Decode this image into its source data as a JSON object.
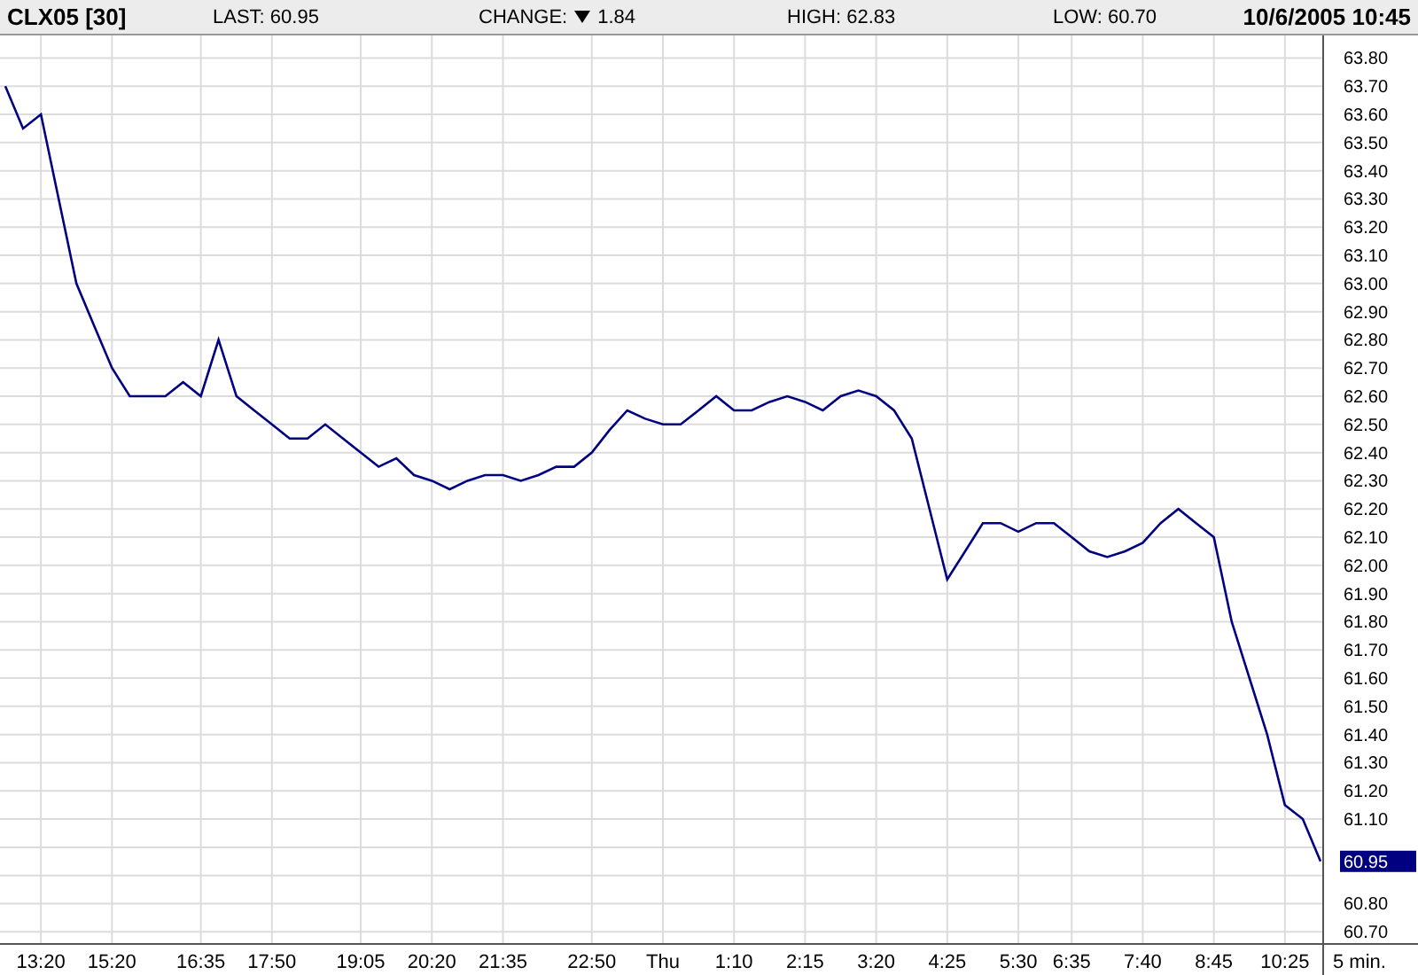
{
  "header": {
    "symbol": "CLX05 [30]",
    "last": "LAST: 60.95",
    "change_label": "CHANGE:",
    "change_value": "1.84",
    "high": "HIGH: 62.83",
    "low": "LOW: 60.70",
    "datetime": "10/6/2005 10:45"
  },
  "chart": {
    "last_marker": "60.95",
    "chart_data": {
      "type": "line",
      "grid": true,
      "xlabel": "5 min.",
      "ylim": [
        60.66,
        63.88
      ],
      "categories": [
        null,
        null,
        "13:20",
        null,
        null,
        null,
        "15:20",
        null,
        null,
        null,
        null,
        "16:35",
        null,
        null,
        null,
        "17:50",
        null,
        null,
        null,
        null,
        "19:05",
        null,
        null,
        null,
        "20:20",
        null,
        null,
        null,
        "21:35",
        null,
        null,
        null,
        null,
        "22:50",
        null,
        null,
        null,
        "Thu",
        null,
        null,
        null,
        "1:10",
        null,
        null,
        null,
        "2:15",
        null,
        null,
        null,
        "3:20",
        null,
        null,
        null,
        "4:25",
        null,
        null,
        null,
        "5:30",
        null,
        null,
        "6:35",
        null,
        null,
        null,
        "7:40",
        null,
        null,
        null,
        "8:45",
        null,
        null,
        null,
        "10:25",
        null,
        null
      ],
      "series": [
        {
          "color": "#000080",
          "values": [
            63.7,
            63.55,
            63.6,
            63.3,
            63.0,
            62.85,
            62.7,
            62.6,
            62.6,
            62.6,
            62.65,
            62.6,
            62.8,
            62.6,
            62.55,
            62.5,
            62.45,
            62.45,
            62.5,
            62.45,
            62.4,
            62.35,
            62.38,
            62.32,
            62.3,
            62.27,
            62.3,
            62.32,
            62.32,
            62.3,
            62.32,
            62.35,
            62.35,
            62.4,
            62.48,
            62.55,
            62.52,
            62.5,
            62.5,
            62.55,
            62.6,
            62.55,
            62.55,
            62.58,
            62.6,
            62.58,
            62.55,
            62.6,
            62.62,
            62.6,
            62.55,
            62.45,
            62.2,
            61.95,
            62.05,
            62.15,
            62.15,
            62.12,
            62.15,
            62.15,
            62.1,
            62.05,
            62.03,
            62.05,
            62.08,
            62.15,
            62.2,
            62.15,
            62.1,
            61.8,
            61.6,
            61.4,
            61.15,
            61.1,
            60.95
          ]
        }
      ],
      "yticks": [
        {
          "value": 60.7,
          "label": "60.70"
        },
        {
          "value": 60.8,
          "label": "60.80"
        },
        {
          "value": 61.1,
          "label": "61.10"
        },
        {
          "value": 61.2,
          "label": "61.20"
        },
        {
          "value": 61.3,
          "label": "61.30"
        },
        {
          "value": 61.4,
          "label": "61.40"
        },
        {
          "value": 61.5,
          "label": "61.50"
        },
        {
          "value": 61.6,
          "label": "61.60"
        },
        {
          "value": 61.7,
          "label": "61.70"
        },
        {
          "value": 61.8,
          "label": "61.80"
        },
        {
          "value": 61.9,
          "label": "61.90"
        },
        {
          "value": 62.0,
          "label": "62.00"
        },
        {
          "value": 62.1,
          "label": "62.10"
        },
        {
          "value": 62.2,
          "label": "62.20"
        },
        {
          "value": 62.3,
          "label": "62.30"
        },
        {
          "value": 62.4,
          "label": "62.40"
        },
        {
          "value": 62.5,
          "label": "62.50"
        },
        {
          "value": 62.6,
          "label": "62.60"
        },
        {
          "value": 62.7,
          "label": "62.70"
        },
        {
          "value": 62.8,
          "label": "62.80"
        },
        {
          "value": 62.9,
          "label": "62.90"
        },
        {
          "value": 63.0,
          "label": "63.00"
        },
        {
          "value": 63.1,
          "label": "63.10"
        },
        {
          "value": 63.2,
          "label": "63.20"
        },
        {
          "value": 63.3,
          "label": "63.30"
        },
        {
          "value": 63.4,
          "label": "63.40"
        },
        {
          "value": 63.5,
          "label": "63.50"
        },
        {
          "value": 63.6,
          "label": "63.60"
        },
        {
          "value": 63.7,
          "label": "63.70"
        },
        {
          "value": 63.8,
          "label": "63.80"
        }
      ]
    }
  }
}
